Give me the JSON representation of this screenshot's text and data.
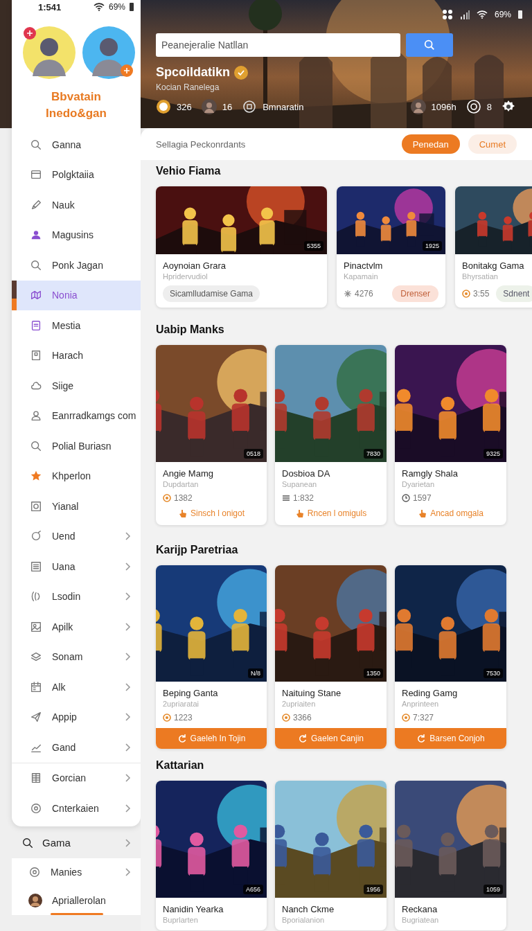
{
  "status_bar": {
    "time": "1:541",
    "battery": "69%"
  },
  "profile": {
    "name_lines": [
      "Bbvatain",
      "Inedo&gan"
    ]
  },
  "sidebar": {
    "items": [
      {
        "label": "Ganna",
        "selected": false,
        "chevron": false
      },
      {
        "label": "Polgktaiia",
        "selected": false,
        "chevron": false
      },
      {
        "label": "Nauk",
        "selected": false,
        "chevron": false
      },
      {
        "label": "Magusins",
        "selected": false,
        "chevron": false
      },
      {
        "label": "Ponk Jagan",
        "selected": false,
        "chevron": false
      },
      {
        "label": "Nonia",
        "selected": true,
        "chevron": false
      },
      {
        "label": "Mestia",
        "selected": false,
        "chevron": false
      },
      {
        "label": "Harach",
        "selected": false,
        "chevron": false
      },
      {
        "label": "Siige",
        "selected": false,
        "chevron": false
      },
      {
        "label": "Eanrradkamgs com",
        "selected": false,
        "chevron": false
      },
      {
        "label": "Polial Buriasn",
        "selected": false,
        "chevron": false
      },
      {
        "label": "Khperlon",
        "selected": false,
        "chevron": false
      },
      {
        "label": "Yianal",
        "selected": false,
        "chevron": false
      },
      {
        "label": "Uend",
        "selected": false,
        "chevron": true
      },
      {
        "label": "Uana",
        "selected": false,
        "chevron": true
      },
      {
        "label": "Lsodin",
        "selected": false,
        "chevron": true
      },
      {
        "label": "Apilk",
        "selected": false,
        "chevron": true
      },
      {
        "label": "Sonam",
        "selected": false,
        "chevron": true
      },
      {
        "label": "Alk",
        "selected": false,
        "chevron": true
      },
      {
        "label": "Appip",
        "selected": false,
        "chevron": true
      },
      {
        "label": "Gand",
        "selected": false,
        "chevron": true
      }
    ],
    "more_items": [
      {
        "label": "Gorcian",
        "selected": false,
        "chevron": true
      },
      {
        "label": "Cnterkaien",
        "selected": false,
        "chevron": true
      }
    ],
    "footer_link": {
      "label": "Gama"
    },
    "footer_items": [
      {
        "label": "Manies",
        "selected": false,
        "chevron": true
      },
      {
        "label": "Apriallerolan",
        "selected": true,
        "chevron": false
      }
    ]
  },
  "hero": {
    "battery": "69%",
    "search": {
      "placeholder": "Peanejeralie Natllan"
    },
    "title": "Spcoildatikn",
    "subtitle": "Kocian Ranelega",
    "stats": [
      {
        "kind": "coin",
        "label": "326"
      },
      {
        "kind": "avatar",
        "label": "16"
      },
      {
        "kind": "emblem",
        "label": "Bmnaratin"
      },
      {
        "kind": "avatar",
        "label": "1096h"
      },
      {
        "kind": "ring",
        "label": "8"
      }
    ]
  },
  "panel": {
    "heading": "Sellagia Peckonrdants",
    "tabs": [
      {
        "label": "Penedan",
        "selected": true
      },
      {
        "label": "Cumet",
        "selected": false
      }
    ]
  },
  "sections": [
    {
      "title": "Vehio Fiama",
      "kind": "featured",
      "cards": [
        {
          "kind": "large",
          "title": "Aoynoian Grara",
          "subtitle": "Hpridervudiol",
          "badge": "5355",
          "chip": "Sicamlludamise Gama"
        },
        {
          "kind": "small",
          "title": "Pinactvlm",
          "subtitle": "Kapamain",
          "badge": "1925",
          "stat": "4276",
          "pill": {
            "label": "Drenser",
            "color": "#fbe1d8"
          }
        },
        {
          "kind": "small",
          "title": "Bonitakg Gama",
          "subtitle": "Bhyrsatian",
          "stat": "3:55",
          "pill": {
            "label": "Sdnent",
            "color": "#edf2ea"
          }
        }
      ]
    },
    {
      "title": "Uabip Manks",
      "kind": "action",
      "cards": [
        {
          "title": "Angie Mamg",
          "subtitle": "Dupdartan",
          "badge": "0518",
          "stat": "1382",
          "action": "Sinsch l onigot"
        },
        {
          "title": "Dosbioa DA",
          "subtitle": "Supanean",
          "badge": "7830",
          "stat": "1:832",
          "action": "Rncen l omiguls"
        },
        {
          "title": "Ramgly Shala",
          "subtitle": "Dyarietan",
          "badge": "9325",
          "stat": "1597",
          "action": "Ancad omgala"
        }
      ]
    },
    {
      "title": "Karijp Paretriaa",
      "kind": "button",
      "cards": [
        {
          "title": "Beping Ganta",
          "subtitle": "2upriaratai",
          "badge": "N/8",
          "stat": "1223",
          "action": "Gaeleh In Tojin"
        },
        {
          "title": "Naituing Stane",
          "subtitle": "2upriaiten",
          "badge": "1350",
          "stat": "3366",
          "action": "Gaelen Canjin"
        },
        {
          "title": "Reding Gamg",
          "subtitle": "Anprinteen",
          "badge": "7530",
          "stat": "7:327",
          "action": "Barsen Conjoh"
        }
      ]
    },
    {
      "title": "Kattarian",
      "kind": "plain",
      "cards": [
        {
          "title": "Nanidin Yearka",
          "subtitle": "Buprlarten",
          "badge": "A656"
        },
        {
          "title": "Nanch Ckme",
          "subtitle": "Bporialanion",
          "badge": "1956"
        },
        {
          "title": "Reckana",
          "subtitle": "Bugriatean",
          "badge": "1059"
        }
      ]
    }
  ]
}
